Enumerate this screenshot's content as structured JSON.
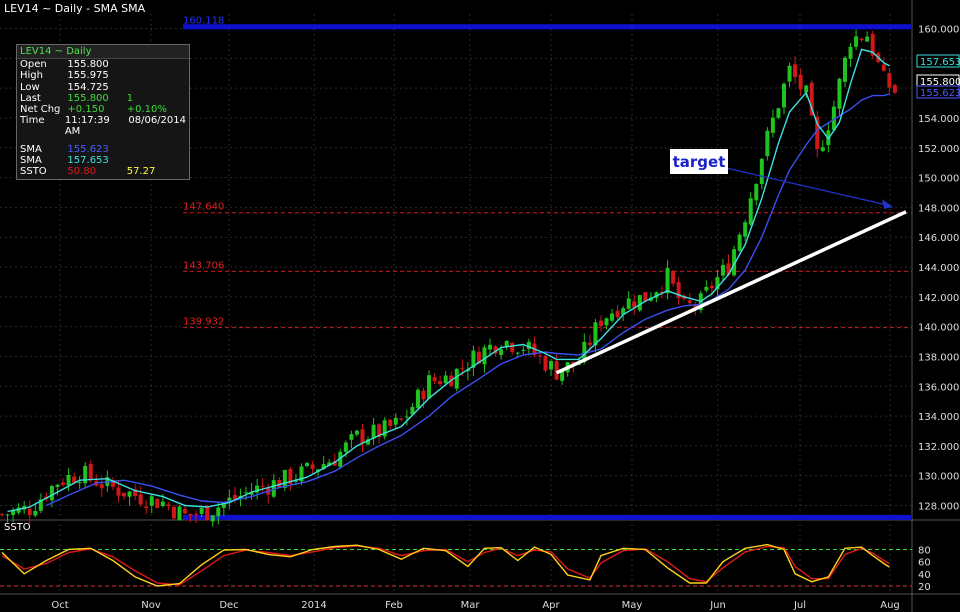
{
  "window": {
    "title": "LEV14 ~ Daily  -  SMA SMA"
  },
  "infobox": {
    "header": "LEV14 ~ Daily",
    "rows": [
      {
        "label": "Open",
        "value": "155.800",
        "extra": "",
        "value_color": "#ffffff"
      },
      {
        "label": "High",
        "value": "155.975",
        "extra": "",
        "value_color": "#ffffff"
      },
      {
        "label": "Low",
        "value": "154.725",
        "extra": "",
        "value_color": "#ffffff"
      },
      {
        "label": "Last",
        "value": "155.800",
        "extra": "1",
        "value_color": "#3ddc3d"
      },
      {
        "label": "Net Chg",
        "value": "+0.150",
        "extra": "+0.10%",
        "value_color": "#3ddc3d"
      },
      {
        "label": "Time",
        "value": "11:17:39 AM",
        "extra": "08/06/2014",
        "value_color": "#ffffff"
      }
    ],
    "indicators": [
      {
        "label": "SMA",
        "value": "155.623",
        "extra": "",
        "value_color": "#4a5cff"
      },
      {
        "label": "SMA",
        "value": "157.653",
        "extra": "",
        "value_color": "#3de0e0"
      },
      {
        "label": "SSTO",
        "value": "50.80",
        "extra": "57.27",
        "value_color": "#e01a1a",
        "extra_color": "#ffff33"
      }
    ]
  },
  "ssto_label": "SSTO",
  "colors": {
    "up": "#1fc21f",
    "down": "#d01818",
    "sma_fast": "#3de0e0",
    "sma_slow": "#3a4ff0",
    "level_red": "#d01818",
    "level_blue": "#1010d0",
    "trendline": "#ffffff",
    "target_arrow": "#2233cc"
  },
  "chart_data": {
    "type": "candlestick",
    "title": "LEV14 ~ Daily  -  SMA SMA",
    "ylim": [
      126.5,
      161
    ],
    "y_ticks": [
      "128.000",
      "130.000",
      "132.000",
      "134.000",
      "136.000",
      "138.000",
      "140.000",
      "142.000",
      "144.000",
      "146.000",
      "148.000",
      "150.000",
      "152.000",
      "154.000",
      "156.000",
      "158.000",
      "160.000"
    ],
    "x_labels": [
      "Oct",
      "Nov",
      "Dec",
      "2014",
      "Feb",
      "Mar",
      "Apr",
      "May",
      "Jun",
      "Jul",
      "Aug"
    ],
    "price_path": [
      [
        0,
        127.4
      ],
      [
        5,
        127.8
      ],
      [
        10,
        129.6
      ],
      [
        14,
        130.2
      ],
      [
        19,
        129.3
      ],
      [
        24,
        128.7
      ],
      [
        29,
        128.2
      ],
      [
        33,
        127.3
      ],
      [
        37,
        127.6
      ],
      [
        41,
        128.3
      ],
      [
        45,
        129.0
      ],
      [
        50,
        129.6
      ],
      [
        55,
        130.3
      ],
      [
        60,
        131.2
      ],
      [
        64,
        132.6
      ],
      [
        68,
        132.9
      ],
      [
        72,
        133.6
      ],
      [
        77,
        136.3
      ],
      [
        81,
        136.7
      ],
      [
        86,
        138.2
      ],
      [
        90,
        139.1
      ],
      [
        94,
        138.7
      ],
      [
        98,
        137.6
      ],
      [
        100,
        137.0
      ],
      [
        104,
        137.6
      ],
      [
        108,
        140.5
      ],
      [
        112,
        141.6
      ],
      [
        116,
        142.0
      ],
      [
        120,
        143.3
      ],
      [
        123,
        141.2
      ],
      [
        126,
        141.6
      ],
      [
        128,
        142.8
      ],
      [
        131,
        144.1
      ],
      [
        134,
        147.5
      ],
      [
        137,
        151.5
      ],
      [
        140,
        155.0
      ],
      [
        142,
        157.2
      ],
      [
        145,
        155.5
      ],
      [
        147,
        151.5
      ],
      [
        150,
        154.8
      ],
      [
        153,
        159.3
      ],
      [
        156,
        159.6
      ],
      [
        159,
        156.5
      ],
      [
        161,
        155.8
      ]
    ],
    "sma_fast": [
      [
        1,
        127.6
      ],
      [
        5,
        127.9
      ],
      [
        10,
        128.9
      ],
      [
        14,
        129.7
      ],
      [
        19,
        129.8
      ],
      [
        24,
        129.0
      ],
      [
        29,
        128.6
      ],
      [
        33,
        128.0
      ],
      [
        37,
        127.9
      ],
      [
        41,
        128.2
      ],
      [
        45,
        128.9
      ],
      [
        50,
        129.4
      ],
      [
        55,
        129.9
      ],
      [
        60,
        130.9
      ],
      [
        64,
        132.0
      ],
      [
        68,
        132.7
      ],
      [
        72,
        133.3
      ],
      [
        77,
        135.2
      ],
      [
        81,
        136.4
      ],
      [
        86,
        137.6
      ],
      [
        90,
        138.6
      ],
      [
        94,
        138.8
      ],
      [
        98,
        138.2
      ],
      [
        100,
        137.8
      ],
      [
        104,
        137.8
      ],
      [
        108,
        139.2
      ],
      [
        112,
        140.8
      ],
      [
        116,
        141.7
      ],
      [
        120,
        142.4
      ],
      [
        123,
        142.0
      ],
      [
        126,
        141.7
      ],
      [
        128,
        142.2
      ],
      [
        131,
        143.5
      ],
      [
        134,
        145.5
      ],
      [
        137,
        148.6
      ],
      [
        140,
        152.3
      ],
      [
        142,
        154.4
      ],
      [
        145,
        155.7
      ],
      [
        147,
        153.6
      ],
      [
        149,
        152.6
      ],
      [
        151,
        153.7
      ],
      [
        153,
        156.3
      ],
      [
        155,
        158.6
      ],
      [
        157,
        158.4
      ],
      [
        159,
        157.7
      ],
      [
        160,
        157.5
      ]
    ],
    "sma_slow": [
      [
        8,
        128.0
      ],
      [
        12,
        128.7
      ],
      [
        17,
        129.5
      ],
      [
        22,
        129.7
      ],
      [
        27,
        129.3
      ],
      [
        32,
        128.7
      ],
      [
        36,
        128.3
      ],
      [
        40,
        128.2
      ],
      [
        45,
        128.6
      ],
      [
        50,
        129.2
      ],
      [
        55,
        129.6
      ],
      [
        60,
        130.3
      ],
      [
        64,
        131.2
      ],
      [
        68,
        132.0
      ],
      [
        72,
        132.7
      ],
      [
        77,
        134.0
      ],
      [
        81,
        135.3
      ],
      [
        86,
        136.5
      ],
      [
        90,
        137.5
      ],
      [
        94,
        138.1
      ],
      [
        98,
        138.3
      ],
      [
        100,
        138.2
      ],
      [
        104,
        138.1
      ],
      [
        108,
        138.5
      ],
      [
        112,
        139.6
      ],
      [
        116,
        140.5
      ],
      [
        120,
        141.1
      ],
      [
        123,
        141.4
      ],
      [
        126,
        141.5
      ],
      [
        128,
        141.8
      ],
      [
        131,
        142.5
      ],
      [
        134,
        143.8
      ],
      [
        137,
        146.0
      ],
      [
        140,
        148.8
      ],
      [
        142,
        150.5
      ],
      [
        145,
        152.2
      ],
      [
        147,
        153.2
      ],
      [
        150,
        153.9
      ],
      [
        153,
        154.6
      ],
      [
        155,
        155.2
      ],
      [
        157,
        155.5
      ],
      [
        159,
        155.5
      ],
      [
        160,
        155.6
      ]
    ],
    "levels": [
      {
        "label": "160.118",
        "value": 160.118,
        "color": "blue"
      },
      {
        "label": "147.640",
        "value": 147.64,
        "color": "red"
      },
      {
        "label": "143.706",
        "value": 143.706,
        "color": "red"
      },
      {
        "label": "139.932",
        "value": 139.932,
        "color": "red"
      },
      {
        "label": "",
        "value": 127.2,
        "color": "blue"
      }
    ],
    "trendline": [
      [
        100,
        136.9
      ],
      [
        163,
        147.7
      ]
    ],
    "target_annotation": {
      "text": "target",
      "from": [
        143,
        150.5
      ],
      "to": [
        161,
        147.9
      ]
    },
    "price_tags": [
      {
        "text": "157.653",
        "value": 157.653,
        "color": "#3de0e0"
      },
      {
        "text": "155.800",
        "value": 155.8,
        "color": "#ffffff"
      },
      {
        "text": "155.623",
        "value": 155.623,
        "color": "#4a5cff"
      }
    ],
    "ssto": {
      "ylim": [
        10,
        95
      ],
      "y_ticks": [
        "20",
        "40",
        "60",
        "80"
      ],
      "guides": [
        {
          "value": 80,
          "color": "#33dd33"
        },
        {
          "value": 20,
          "color": "#dd3333"
        }
      ],
      "k_path": [
        [
          0,
          75
        ],
        [
          4,
          40
        ],
        [
          8,
          62
        ],
        [
          12,
          80
        ],
        [
          16,
          82
        ],
        [
          20,
          62
        ],
        [
          24,
          35
        ],
        [
          28,
          20
        ],
        [
          32,
          24
        ],
        [
          36,
          55
        ],
        [
          40,
          79
        ],
        [
          44,
          80
        ],
        [
          48,
          72
        ],
        [
          52,
          68
        ],
        [
          56,
          80
        ],
        [
          60,
          85
        ],
        [
          64,
          87
        ],
        [
          68,
          80
        ],
        [
          72,
          64
        ],
        [
          76,
          82
        ],
        [
          80,
          78
        ],
        [
          84,
          52
        ],
        [
          87,
          82
        ],
        [
          90,
          83
        ],
        [
          93,
          62
        ],
        [
          96,
          84
        ],
        [
          99,
          72
        ],
        [
          102,
          38
        ],
        [
          106,
          30
        ],
        [
          108,
          70
        ],
        [
          112,
          82
        ],
        [
          116,
          80
        ],
        [
          120,
          50
        ],
        [
          124,
          25
        ],
        [
          127,
          25
        ],
        [
          130,
          60
        ],
        [
          134,
          82
        ],
        [
          138,
          88
        ],
        [
          141,
          80
        ],
        [
          143,
          40
        ],
        [
          146,
          27
        ],
        [
          149,
          35
        ],
        [
          152,
          82
        ],
        [
          155,
          84
        ],
        [
          157,
          70
        ],
        [
          159,
          57
        ],
        [
          160,
          51
        ]
      ],
      "d_path": [
        [
          0,
          70
        ],
        [
          4,
          48
        ],
        [
          8,
          57
        ],
        [
          12,
          75
        ],
        [
          16,
          81
        ],
        [
          20,
          68
        ],
        [
          24,
          45
        ],
        [
          28,
          25
        ],
        [
          32,
          22
        ],
        [
          36,
          45
        ],
        [
          40,
          70
        ],
        [
          44,
          79
        ],
        [
          48,
          75
        ],
        [
          52,
          70
        ],
        [
          56,
          76
        ],
        [
          60,
          83
        ],
        [
          64,
          86
        ],
        [
          68,
          82
        ],
        [
          72,
          70
        ],
        [
          76,
          78
        ],
        [
          80,
          80
        ],
        [
          84,
          60
        ],
        [
          87,
          75
        ],
        [
          90,
          82
        ],
        [
          93,
          70
        ],
        [
          96,
          79
        ],
        [
          99,
          76
        ],
        [
          102,
          48
        ],
        [
          106,
          33
        ],
        [
          108,
          58
        ],
        [
          112,
          78
        ],
        [
          116,
          81
        ],
        [
          120,
          60
        ],
        [
          124,
          32
        ],
        [
          127,
          27
        ],
        [
          130,
          50
        ],
        [
          134,
          76
        ],
        [
          138,
          85
        ],
        [
          141,
          83
        ],
        [
          143,
          52
        ],
        [
          146,
          32
        ],
        [
          149,
          32
        ],
        [
          152,
          72
        ],
        [
          155,
          82
        ],
        [
          157,
          74
        ],
        [
          159,
          62
        ],
        [
          160,
          57
        ]
      ]
    }
  }
}
